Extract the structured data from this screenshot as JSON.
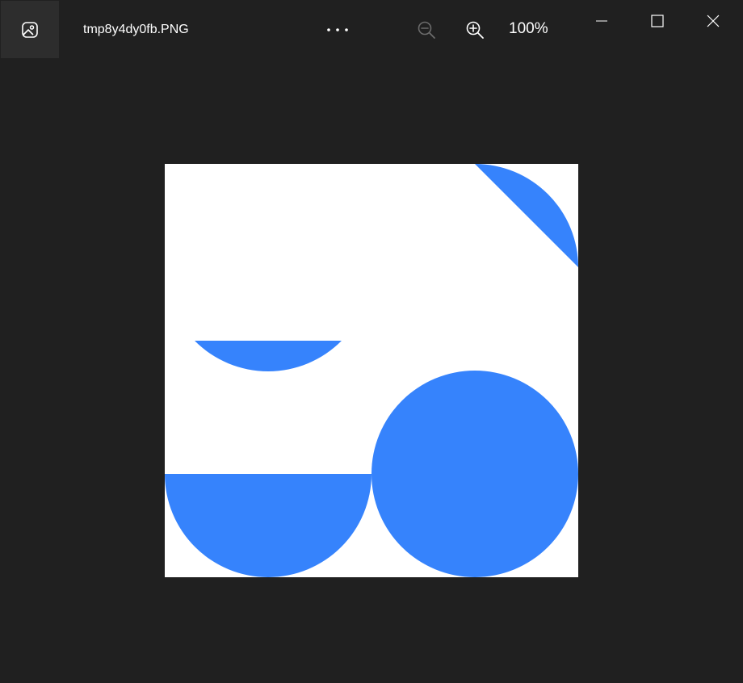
{
  "window": {
    "title": "tmp8y4dy0fb.PNG",
    "zoom_level": "100%"
  },
  "toolbar": {
    "app_icon": "photo-app-icon",
    "more_icon": "more-options-icon",
    "zoom_out_icon": "zoom-out-icon",
    "zoom_in_icon": "zoom-in-icon"
  },
  "controls": {
    "minimize_icon": "minimize-icon",
    "maximize_icon": "maximize-icon",
    "close_icon": "close-icon"
  },
  "image": {
    "background": "#ffffff",
    "shape_color": "#3683fc"
  },
  "colors": {
    "window_bg": "#202020",
    "titlebar_icon_bg": "#2d2d2d",
    "text": "#ffffff",
    "disabled_icon": "#6b6b6b"
  }
}
